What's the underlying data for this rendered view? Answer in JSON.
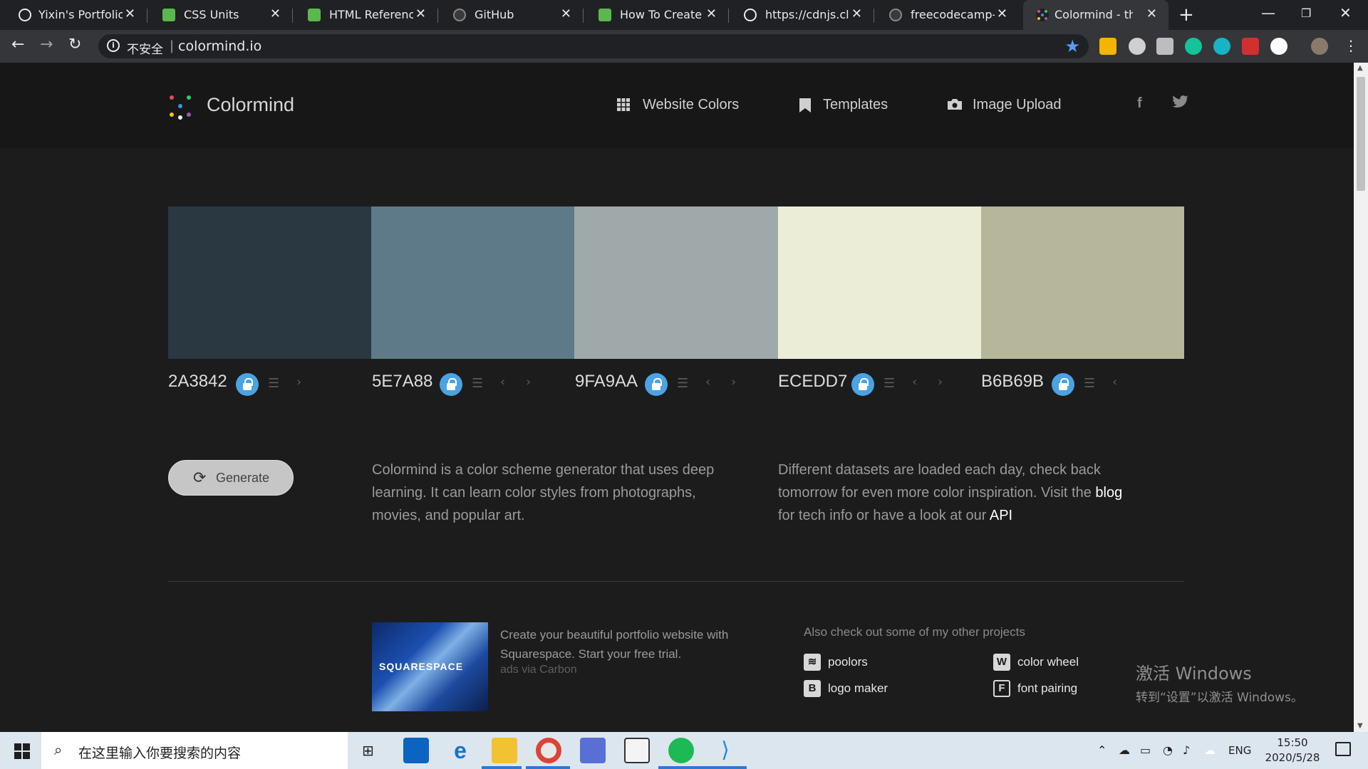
{
  "browser": {
    "tabs": [
      {
        "title": "Yixin's Portfolio P",
        "icon": "globe-icon"
      },
      {
        "title": "CSS Units",
        "icon": "w3-icon"
      },
      {
        "title": "HTML Reference",
        "icon": "w3-icon"
      },
      {
        "title": "GitHub",
        "icon": "github-icon"
      },
      {
        "title": "How To Create a",
        "icon": "w3-icon"
      },
      {
        "title": "https://cdnjs.clou",
        "icon": "globe-icon"
      },
      {
        "title": "freecodecamp-co",
        "icon": "github-icon"
      },
      {
        "title": "Colormind - the",
        "icon": "colormind-icon",
        "active": true
      }
    ],
    "new_tab": "+",
    "omnibox": {
      "security_label": "不安全",
      "url": "colormind.io"
    }
  },
  "site": {
    "logo_text": "Colormind",
    "logo_dot_colors": [
      "#e84a5f",
      "#2ecc71",
      "#3498db",
      "#f1c40f",
      "#9b59b6",
      "#ecf0f1"
    ],
    "nav": [
      {
        "label": "Website Colors",
        "icon": "grid-icon"
      },
      {
        "label": "Templates",
        "icon": "bookmark-icon"
      },
      {
        "label": "Image Upload",
        "icon": "camera-icon"
      }
    ],
    "social": [
      {
        "label": "f",
        "icon": "facebook-icon"
      },
      {
        "label": "t",
        "icon": "twitter-icon"
      }
    ],
    "palette": [
      {
        "hex": "2A3842",
        "color": "#2A3842"
      },
      {
        "hex": "5E7A88",
        "color": "#5E7A88"
      },
      {
        "hex": "9FA9AA",
        "color": "#9FA9AA"
      },
      {
        "hex": "ECEDD7",
        "color": "#ECEDD7"
      },
      {
        "hex": "B6B69B",
        "color": "#B6B69B"
      }
    ],
    "generate_label": "Generate",
    "description_1": "Colormind is a color scheme generator that uses deep learning. It can learn color styles from photographs, movies, and popular art.",
    "description_2_pre": "Different datasets are loaded each day, check back tomorrow for even more color inspiration. Visit the ",
    "description_2_blog": "blog",
    "description_2_mid": " for tech info or have a look at our ",
    "description_2_api": "API",
    "ad": {
      "brand": "SQUARESPACE",
      "text": "Create your beautiful portfolio website with Squarespace. Start your free trial.",
      "via": "ads via Carbon"
    },
    "projects_title": "Also check out some of my other projects",
    "projects": [
      {
        "label": "poolors",
        "icon": "poolors-icon"
      },
      {
        "label": "color wheel",
        "icon": "color-wheel-icon"
      },
      {
        "label": "logo maker",
        "icon": "logo-maker-icon"
      },
      {
        "label": "font pairing",
        "icon": "font-pairing-icon"
      }
    ]
  },
  "windows": {
    "activate_line1": "激活 Windows",
    "activate_line2": "转到“设置”以激活 Windows。",
    "search_placeholder": "在这里输入你要搜索的内容",
    "language": "ENG",
    "time": "15:50",
    "date": "2020/5/28"
  }
}
